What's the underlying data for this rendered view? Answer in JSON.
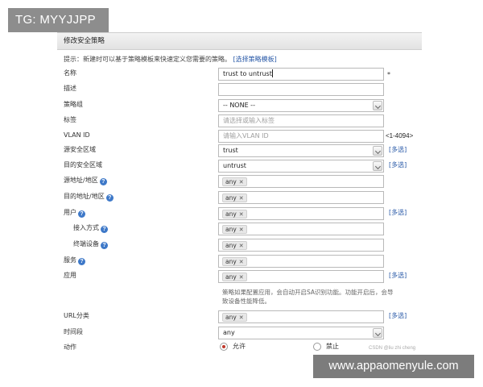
{
  "watermark_top": "TG: MYYJJPP",
  "watermark_bottom": "www.appaomenyule.com",
  "credit": "CSDN @liu zhi cheng",
  "panel": {
    "title": "修改安全策略"
  },
  "tip": {
    "text": "提示：新建时可以基于策略模板来快速定义您需要的策略。",
    "link": "[选择策略模板]"
  },
  "form": {
    "name": {
      "label": "名称",
      "value": "trust to untrust",
      "required_mark": "*"
    },
    "description": {
      "label": "描述",
      "value": ""
    },
    "policy_group": {
      "label": "策略组",
      "selected": "-- NONE --"
    },
    "tags": {
      "label": "标签",
      "placeholder": "请选择或输入标签"
    },
    "vlan": {
      "label": "VLAN ID",
      "placeholder": "请输入VLAN ID",
      "range": "<1-4094>"
    },
    "src_zone": {
      "label": "源安全区域",
      "selected": "trust",
      "multi": "[多选]"
    },
    "dst_zone": {
      "label": "目的安全区域",
      "selected": "untrust",
      "multi": "[多选]"
    },
    "src_addr": {
      "label": "源地址/地区",
      "tag": "any"
    },
    "dst_addr": {
      "label": "目的地址/地区",
      "tag": "any"
    },
    "user": {
      "label": "用户",
      "tag": "any",
      "multi": "[多选]"
    },
    "access_mode": {
      "label": "接入方式",
      "tag": "any"
    },
    "terminal": {
      "label": "终端设备",
      "tag": "any"
    },
    "service": {
      "label": "服务",
      "tag": "any"
    },
    "application": {
      "label": "应用",
      "tag": "any",
      "multi": "[多选]",
      "note": "策略如果配置应用，会自动开启SA识别功能。功能开启后，会导致设备性能降低。"
    },
    "url_category": {
      "label": "URL分类",
      "tag": "any",
      "multi": "[多选]"
    },
    "time_range": {
      "label": "时间段",
      "selected": "any"
    },
    "action": {
      "label": "动作",
      "allow": "允许",
      "deny": "禁止",
      "selected": "allow"
    }
  },
  "colors": {
    "link": "#2a5aa8",
    "help_icon": "#3d78c8",
    "radio_selected": "#c0392b"
  }
}
